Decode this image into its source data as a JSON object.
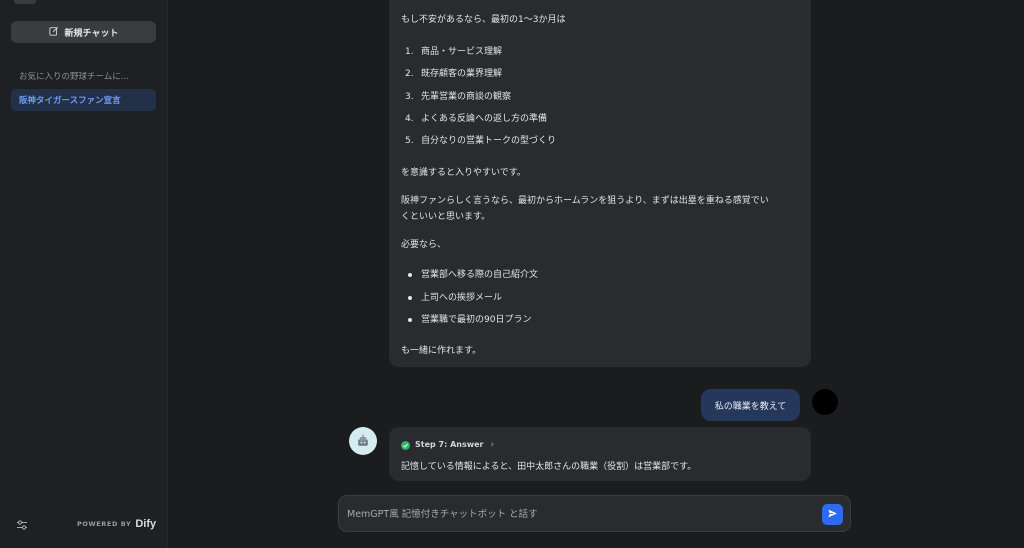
{
  "sidebar": {
    "new_chat_label": "新規チャット",
    "conversations": [
      {
        "label": "お気に入りの野球チームに..."
      },
      {
        "label": "阪神タイガースファン宣言"
      }
    ],
    "powered_label": "POWERED BY",
    "powered_brand": "Dify"
  },
  "chat": {
    "msg1": {
      "intro": "もし不安があるなら、最初の1〜3か月は",
      "ordered": [
        "商品・サービス理解",
        "既存顧客の業界理解",
        "先輩営業の商談の観察",
        "よくある反論への返し方の準備",
        "自分なりの営業トークの型づくり"
      ],
      "after_ordered": "を意識すると入りやすいです。",
      "para_line1": "阪神ファンらしく言うなら、最初からホームランを狙うより、まずは出塁を重ねる感覚でい",
      "para_line2": "くといいと思います。",
      "need": "必要なら、",
      "bullets": [
        "営業部へ移る際の自己紹介文",
        "上司への挨拶メール",
        "営業職で最初の90日プラン"
      ],
      "outro": "も一緒に作れます。"
    },
    "user_message": "私の職業を教えて",
    "msg2": {
      "step_label": "Step 7: Answer",
      "answer": "記憶している情報によると、田中太郎さんの職業（役割）は営業部です。"
    }
  },
  "input": {
    "placeholder": "MemGPT風 記憶付きチャットボット と話す"
  },
  "colors": {
    "accent": "#2f6bf0",
    "selected_conv_bg": "#23304a",
    "selected_conv_text": "#6f9cf2",
    "user_bubble": "#26375c",
    "step_success": "#2fb36a"
  },
  "icons": [
    "edit-icon",
    "settings-sliders-icon",
    "check-icon",
    "chevron-right-icon",
    "send-icon",
    "bot-avatar-icon"
  ]
}
